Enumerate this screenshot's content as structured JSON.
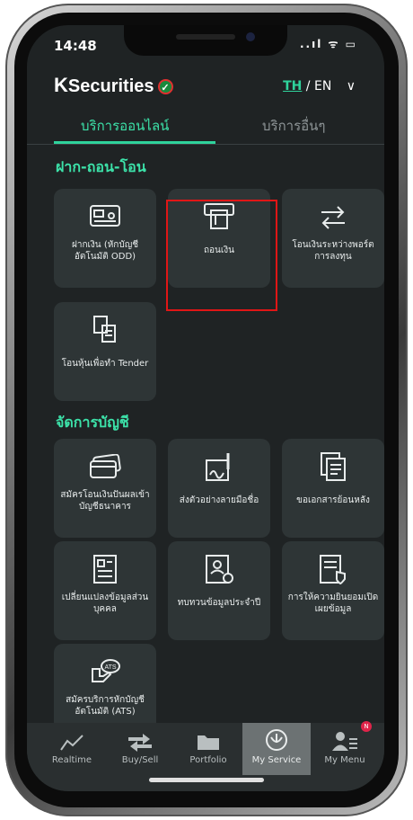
{
  "status": {
    "time": "14:48",
    "right": "..ıl ᯤ ▭"
  },
  "header": {
    "brand_k": "K",
    "brand_rest": "Securities",
    "lang_th": "TH",
    "lang_sep": " / EN",
    "chevron": "∨"
  },
  "tabs": {
    "active": "บริการออนไลน์",
    "inactive": "บริการอื่นๆ"
  },
  "sections": {
    "deposit": "ฝาก-ถอน-โอน",
    "account": "จัดการบัญชี"
  },
  "cards": [
    {
      "label": "ฝากเงิน (หักบัญชีอัตโนมัติ ODD)",
      "icon": "deposit-card-icon"
    },
    {
      "label": "ถอนเงิน",
      "icon": "withdraw-atm-icon"
    },
    {
      "label": "โอนเงินระหว่างพอร์ตการลงทุน",
      "icon": "transfer-arrows-icon"
    },
    {
      "label": "โอนหุ้นเพื่อทำ Tender",
      "icon": "tender-docs-icon"
    },
    {
      "label": "สมัครโอนเงินปันผลเข้าบัญชีธนาคาร",
      "icon": "bank-card-icon"
    },
    {
      "label": "ส่งตัวอย่างลายมือชื่อ",
      "icon": "signature-icon"
    },
    {
      "label": "ขอเอกสารย้อนหลัง",
      "icon": "documents-icon"
    },
    {
      "label": "เปลี่ยนแปลงข้อมูลส่วนบุคคล",
      "icon": "profile-form-icon"
    },
    {
      "label": "ทบทวนข้อมูลประจำปี",
      "icon": "annual-review-icon"
    },
    {
      "label": "การให้ความยินยอมเปิดเผยข้อมูล",
      "icon": "consent-icon"
    },
    {
      "label": "สมัครบริการหักบัญชีอัตโนมัติ (ATS)",
      "icon": "ats-icon"
    }
  ],
  "nav": [
    {
      "label": "Realtime",
      "icon": "realtime-chart-icon"
    },
    {
      "label": "Buy/Sell",
      "icon": "buy-sell-arrows-icon"
    },
    {
      "label": "Portfolio",
      "icon": "portfolio-folder-icon"
    },
    {
      "label": "My Service",
      "icon": "my-service-icon"
    },
    {
      "label": "My Menu",
      "icon": "my-menu-icon",
      "badge": "N"
    }
  ],
  "colors": {
    "accent": "#3ce2a9",
    "background": "#1f2324",
    "card": "#2e3536",
    "highlight": "#e01616"
  }
}
